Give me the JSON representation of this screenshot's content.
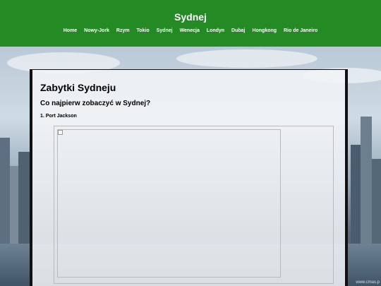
{
  "site": {
    "title": "Sydnej"
  },
  "nav": {
    "items": [
      "Home",
      "Nowy-Jork",
      "Rzym",
      "Tokio",
      "Sydnej",
      "Wenecja",
      "Londyn",
      "Dubaj",
      "Hongkong",
      "Rio de Janeiro"
    ]
  },
  "content": {
    "heading": "Zabytki Sydneju",
    "subheading": "Co najpierw zobaczyć w Sydnej?",
    "item_title": "1. Port Jackson"
  },
  "colors": {
    "header": "#238a24",
    "header_text": "#ffffff"
  },
  "watermark": "www.cmas.p"
}
